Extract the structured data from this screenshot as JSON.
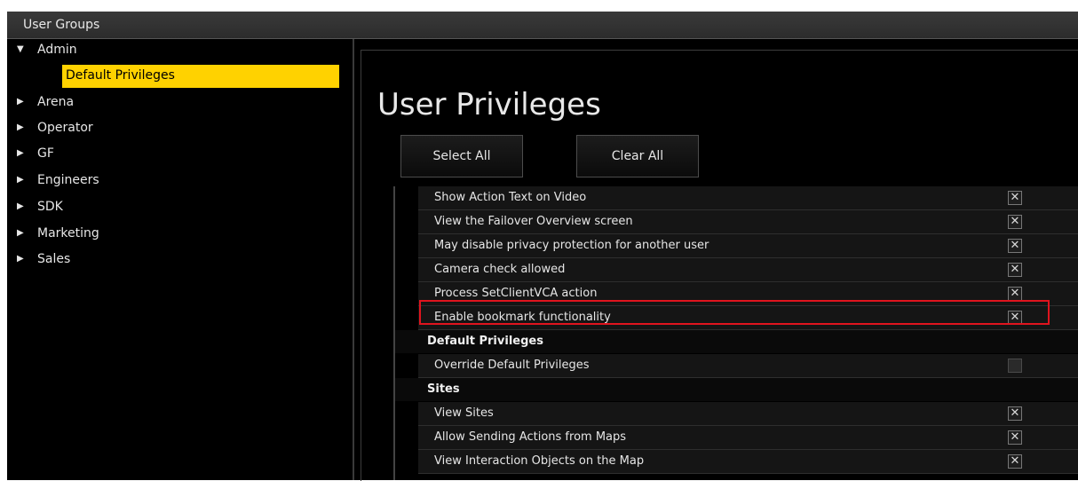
{
  "window": {
    "title": "User Groups"
  },
  "tree": {
    "root": {
      "label": "Admin",
      "expanded": true
    },
    "selected_child": {
      "label": "Default Privileges"
    },
    "groups": [
      {
        "label": "Arena"
      },
      {
        "label": "Operator"
      },
      {
        "label": "GF"
      },
      {
        "label": "Engineers"
      },
      {
        "label": "SDK"
      },
      {
        "label": "Marketing"
      },
      {
        "label": "Sales"
      }
    ]
  },
  "main": {
    "title": "User Privileges",
    "select_all_label": "Select All",
    "clear_all_label": "Clear All"
  },
  "privileges": {
    "rows1": [
      {
        "label": "Show Action Text on Video",
        "checked": true
      },
      {
        "label": "View the Failover Overview screen",
        "checked": true
      },
      {
        "label": "May disable privacy protection for another user",
        "checked": true
      },
      {
        "label": "Camera check allowed",
        "checked": true
      },
      {
        "label": "Process SetClientVCA action",
        "checked": true
      },
      {
        "label": "Enable bookmark functionality",
        "checked": true,
        "highlighted": true
      }
    ],
    "section_default": "Default Privileges",
    "rows2": [
      {
        "label": "Override Default Privileges",
        "checked": false
      }
    ],
    "section_sites": "Sites",
    "rows3": [
      {
        "label": "View Sites",
        "checked": true
      },
      {
        "label": "Allow Sending Actions from Maps",
        "checked": true
      },
      {
        "label": "View Interaction Objects on the Map",
        "checked": true
      }
    ]
  },
  "colors": {
    "selection": "#ffd200",
    "highlight_border": "#e0141e"
  }
}
